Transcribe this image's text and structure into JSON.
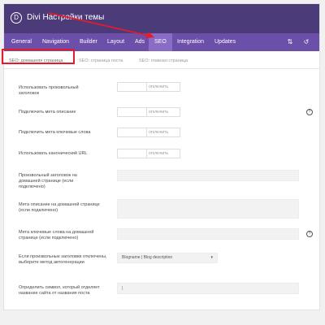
{
  "header": {
    "logo_letter": "D",
    "title": "Divi Настройки темы"
  },
  "mainnav": {
    "tabs": [
      "General",
      "Navigation",
      "Builder",
      "Layout",
      "Ads",
      "SEO",
      "Integration",
      "Updates"
    ],
    "active_tab": "SEO",
    "icons": {
      "sort": "⇅",
      "reset": "↺"
    }
  },
  "subtabs": {
    "items": [
      "SEO: домашняя страница",
      "SEO: страница поста",
      "SEO: главная страница"
    ],
    "active": "SEO: домашняя страница"
  },
  "settings": [
    {
      "label": "Использовать произвольный заголовок",
      "control": "toggle",
      "state": "отключить"
    },
    {
      "label": "Подключить мета описание",
      "control": "toggle",
      "state": "отключить"
    },
    {
      "label": "Подключить мета ключевые слова",
      "control": "toggle",
      "state": "отключить"
    },
    {
      "label": "Использовать канонический URL",
      "control": "toggle",
      "state": "отключить"
    },
    {
      "label": "Произвольный заголовок на домашней странице (если подключено)",
      "control": "text",
      "value": ""
    },
    {
      "label": "Мета описание на домашней странице (если подключено)",
      "control": "textarea",
      "value": ""
    },
    {
      "label": "Мета ключевые слова на домашней странице (если подключено)",
      "control": "text",
      "value": ""
    },
    {
      "label": "Если произвольные заголовки отключены, выберите метод автогенерации",
      "control": "select",
      "value": "Blogname | Blog description"
    },
    {
      "label": "Определить символ, который отделяет название сайта от названия поста",
      "control": "text",
      "value": "|"
    }
  ],
  "help_icon": "?",
  "colors": {
    "header_bg": "#4b3b78",
    "nav_bg": "#6b4fa8",
    "nav_active_bg": "#8a6cc7",
    "annotation_red": "#e21c2c"
  }
}
